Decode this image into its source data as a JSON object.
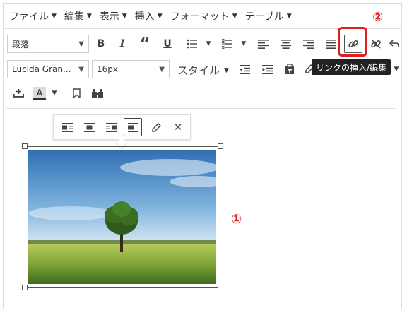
{
  "menubar": {
    "items": [
      "ファイル",
      "編集",
      "表示",
      "挿入",
      "フォーマット",
      "テーブル"
    ]
  },
  "toolbar": {
    "format_select": "段落",
    "font_select": "Lucida Gran...",
    "size_select": "16px",
    "styles_menu": "スタイル"
  },
  "tooltip": {
    "text": "リンクの挿入/編集"
  },
  "annotations": {
    "marker1": "①",
    "marker2": "②",
    "color": "#e02020"
  },
  "icons": {
    "row1": [
      "bold-icon",
      "italic-icon",
      "blockquote-icon",
      "underline-icon",
      "bullet-list-icon",
      "numbered-list-icon",
      "align-left-icon",
      "align-center-icon",
      "align-right-icon",
      "justify-icon",
      "link-icon",
      "unlink-icon",
      "undo-icon"
    ],
    "image_toolbar": [
      "align-left-icon",
      "align-center-icon",
      "align-right-icon",
      "align-none-icon",
      "edit-icon",
      "remove-icon"
    ]
  },
  "labels": {
    "bold": "B",
    "italic": "I",
    "quote": "“",
    "underline": "U"
  }
}
